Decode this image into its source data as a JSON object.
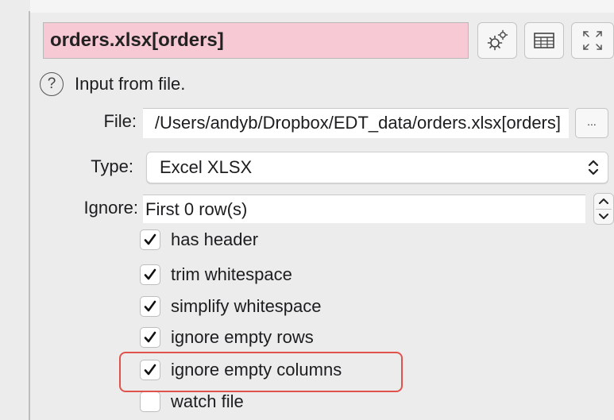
{
  "node": {
    "title": "orders.xlsx[orders]",
    "description": "Input from file.",
    "help_icon": "?",
    "title_color": "#f7c9d4"
  },
  "toolbar": {
    "icons": [
      "gear-icon",
      "table-icon",
      "expand-icon"
    ]
  },
  "file": {
    "label": "File:",
    "value": "/Users/andyb/Dropbox/EDT_data/orders.xlsx[orders]",
    "browse_label": "..."
  },
  "type": {
    "label": "Type:",
    "value": "Excel XLSX"
  },
  "ignore": {
    "label": "Ignore:",
    "value": "First 0 row(s)"
  },
  "options": [
    {
      "label": "has header",
      "checked": true
    },
    {
      "label": "trim whitespace",
      "checked": true
    },
    {
      "label": "simplify whitespace",
      "checked": true
    },
    {
      "label": "ignore empty rows",
      "checked": true
    },
    {
      "label": "ignore empty columns",
      "checked": true
    },
    {
      "label": "watch file",
      "checked": false
    }
  ],
  "highlight_color": "#e0534d"
}
